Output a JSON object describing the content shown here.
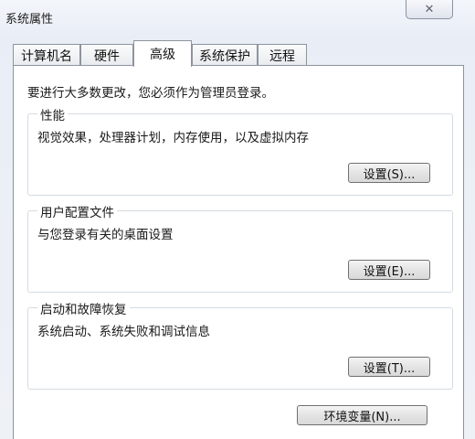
{
  "window": {
    "title": "系统属性",
    "close_label": "☒"
  },
  "tabs": [
    {
      "label": "计算机名"
    },
    {
      "label": "硬件"
    },
    {
      "label": "高级"
    },
    {
      "label": "系统保护"
    },
    {
      "label": "远程"
    }
  ],
  "active_tab": "高级",
  "intro": "要进行大多数更改，您必须作为管理员登录。",
  "groups": [
    {
      "label": "性能",
      "description": "视觉效果，处理器计划，内存使用，以及虚拟内存",
      "button": "设置(S)..."
    },
    {
      "label": "用户配置文件",
      "description": "与您登录有关的桌面设置",
      "button": "设置(E)..."
    },
    {
      "label": "启动和故障恢复",
      "description": "系统启动、系统失败和调试信息",
      "button": "设置(T)..."
    }
  ],
  "env_button": "环境变量(N)..."
}
